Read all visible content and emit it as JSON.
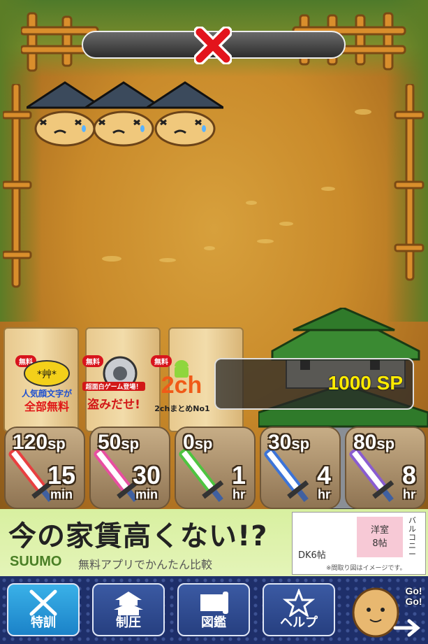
{
  "status": {
    "icon": "cross-icon"
  },
  "apps": [
    {
      "badge": "無料",
      "title": "人気顔文字が",
      "subtitle": "全部無料",
      "icon": "kaomoji-app-icon"
    },
    {
      "badge": "無料",
      "title": "超面白ゲーム登場！",
      "subtitle": "盗みだせ!",
      "icon": "safe-app-icon"
    },
    {
      "badge": "無料",
      "title": "2ch",
      "subtitle": "2chまとめNo1",
      "icon": "android-2ch-app-icon"
    }
  ],
  "sp": {
    "value": "1000 SP"
  },
  "weapons": [
    {
      "cost": "120",
      "unit": "sp",
      "duration": "15",
      "duration_unit": "min",
      "color": "#e84040"
    },
    {
      "cost": "50",
      "unit": "sp",
      "duration": "30",
      "duration_unit": "min",
      "color": "#e84fa0"
    },
    {
      "cost": "0",
      "unit": "sp",
      "duration": "1",
      "duration_unit": "hr",
      "color": "#4fc440"
    },
    {
      "cost": "30",
      "unit": "sp",
      "duration": "4",
      "duration_unit": "hr",
      "color": "#3c74d8"
    },
    {
      "cost": "80",
      "unit": "sp",
      "duration": "8",
      "duration_unit": "hr",
      "color": "#8a5cd0"
    }
  ],
  "ad": {
    "headline": "今の家賃高くない!?",
    "brand": "SUUMO",
    "sub": "無料アプリでかんたん比較",
    "room1": "DK6帖",
    "room2": "洋室",
    "room3": "8帖",
    "balcony": "バルコニー",
    "note": "※間取り図はイメージです。"
  },
  "nav": [
    {
      "label": "特訓",
      "icon": "crossed-swords-icon",
      "active": true
    },
    {
      "label": "制圧",
      "icon": "castle-icon",
      "active": false
    },
    {
      "label": "図鑑",
      "icon": "scroll-icon",
      "active": false
    },
    {
      "label": "ヘルプ",
      "icon": "star-icon",
      "active": false
    }
  ],
  "mascot": {
    "text": "Go! Go!",
    "icon": "mascot-go-icon"
  }
}
